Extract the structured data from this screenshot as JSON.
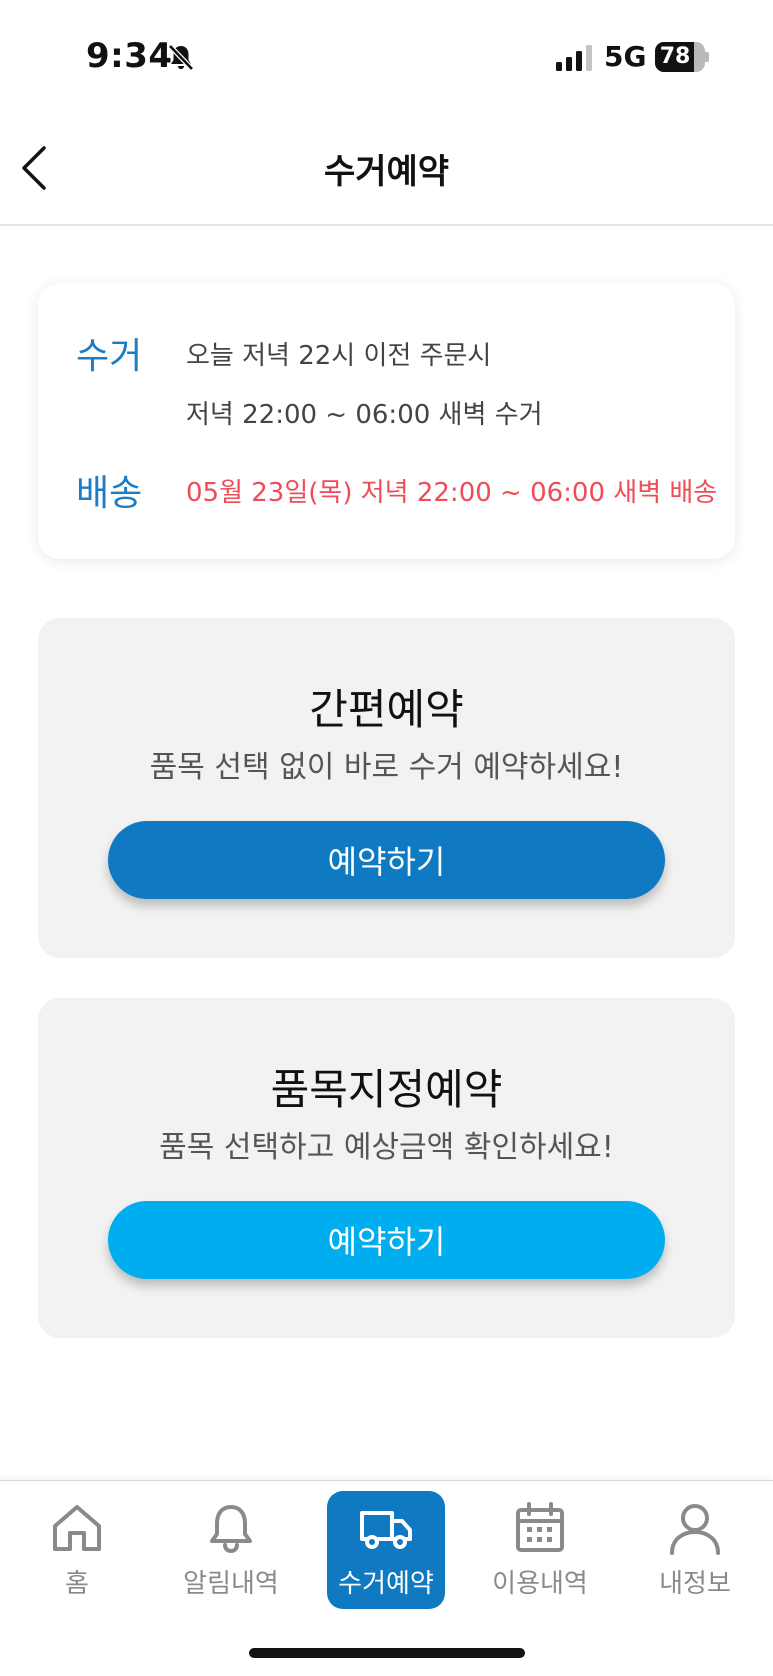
{
  "status_bar": {
    "time": "9:34",
    "network": "5G",
    "battery": 78,
    "battery_text": "78"
  },
  "header": {
    "title": "수거예약"
  },
  "info": {
    "pickup_label": "수거",
    "pickup_line1": "오늘 저녁 22시 이전 주문시",
    "pickup_line2": "저녁 22:00 ~ 06:00 새벽 수거",
    "delivery_label": "배송",
    "delivery_text": "05월 23일(목) 저녁 22:00 ~ 06:00 새벽 배송"
  },
  "simple_reservation": {
    "title": "간편예약",
    "description": "품목 선택 없이 바로 수거 예약하세요!",
    "button_label": "예약하기"
  },
  "item_reservation": {
    "title": "품목지정예약",
    "description": "품목 선택하고 예상금액 확인하세요!",
    "button_label": "예약하기"
  },
  "bottom_nav": {
    "items": [
      {
        "label": "홈",
        "icon": "home-icon"
      },
      {
        "label": "알림내역",
        "icon": "bell-icon"
      },
      {
        "label": "수거예약",
        "icon": "truck-icon",
        "active": true
      },
      {
        "label": "이용내역",
        "icon": "calendar-icon"
      },
      {
        "label": "내정보",
        "icon": "user-icon"
      }
    ]
  },
  "colors": {
    "primary": "#0f79c1",
    "secondary": "#00adee",
    "label_blue": "#1a7dc6",
    "alert_red": "#ef4c57",
    "card_gray": "#f2f2f2"
  }
}
